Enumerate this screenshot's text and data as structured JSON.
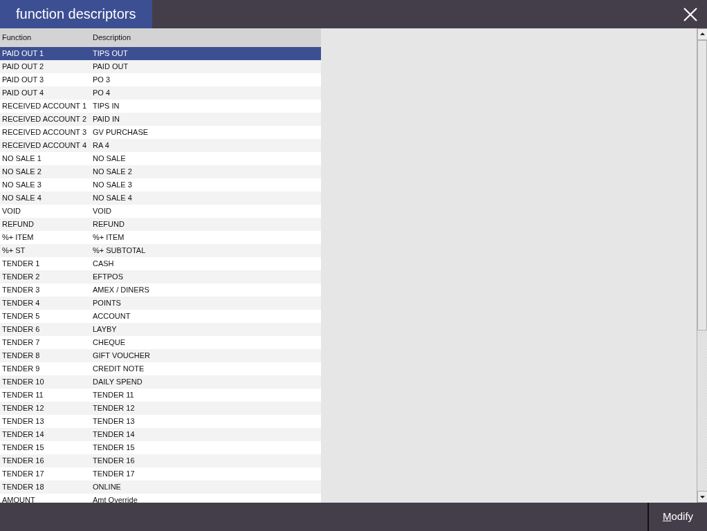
{
  "window": {
    "title": "function descriptors"
  },
  "table": {
    "columns": [
      "Function",
      "Description"
    ],
    "rows": [
      {
        "function": "PAID OUT 1",
        "description": "TIPS OUT",
        "selected": true
      },
      {
        "function": "PAID OUT 2",
        "description": "PAID OUT",
        "selected": false
      },
      {
        "function": "PAID OUT 3",
        "description": "PO 3",
        "selected": false
      },
      {
        "function": "PAID OUT 4",
        "description": "PO 4",
        "selected": false
      },
      {
        "function": "RECEIVED ACCOUNT 1",
        "description": "TIPS IN",
        "selected": false
      },
      {
        "function": "RECEIVED ACCOUNT 2",
        "description": "PAID IN",
        "selected": false
      },
      {
        "function": "RECEIVED ACCOUNT 3",
        "description": "GV PURCHASE",
        "selected": false
      },
      {
        "function": "RECEIVED ACCOUNT 4",
        "description": "RA 4",
        "selected": false
      },
      {
        "function": "NO SALE 1",
        "description": "NO SALE",
        "selected": false
      },
      {
        "function": "NO SALE 2",
        "description": "NO SALE 2",
        "selected": false
      },
      {
        "function": "NO SALE 3",
        "description": "NO SALE 3",
        "selected": false
      },
      {
        "function": "NO SALE 4",
        "description": "NO SALE 4",
        "selected": false
      },
      {
        "function": "VOID",
        "description": "VOID",
        "selected": false
      },
      {
        "function": "REFUND",
        "description": "REFUND",
        "selected": false
      },
      {
        "function": "%+ ITEM",
        "description": "%+ ITEM",
        "selected": false
      },
      {
        "function": "%+ ST",
        "description": "%+ SUBTOTAL",
        "selected": false
      },
      {
        "function": "TENDER 1",
        "description": "CASH",
        "selected": false
      },
      {
        "function": "TENDER 2",
        "description": "EFTPOS",
        "selected": false
      },
      {
        "function": "TENDER 3",
        "description": "AMEX / DINERS",
        "selected": false
      },
      {
        "function": "TENDER 4",
        "description": "POINTS",
        "selected": false
      },
      {
        "function": "TENDER 5",
        "description": "ACCOUNT",
        "selected": false
      },
      {
        "function": "TENDER 6",
        "description": "LAYBY",
        "selected": false
      },
      {
        "function": "TENDER 7",
        "description": "CHEQUE",
        "selected": false
      },
      {
        "function": "TENDER 8",
        "description": "GIFT VOUCHER",
        "selected": false
      },
      {
        "function": "TENDER 9",
        "description": "CREDIT NOTE",
        "selected": false
      },
      {
        "function": "TENDER 10",
        "description": "DAILY SPEND",
        "selected": false
      },
      {
        "function": "TENDER 11",
        "description": "TENDER 11",
        "selected": false
      },
      {
        "function": "TENDER 12",
        "description": "TENDER 12",
        "selected": false
      },
      {
        "function": "TENDER 13",
        "description": "TENDER 13",
        "selected": false
      },
      {
        "function": "TENDER 14",
        "description": "TENDER 14",
        "selected": false
      },
      {
        "function": "TENDER 15",
        "description": "TENDER 15",
        "selected": false
      },
      {
        "function": "TENDER 16",
        "description": "TENDER 16",
        "selected": false
      },
      {
        "function": "TENDER 17",
        "description": "TENDER 17",
        "selected": false
      },
      {
        "function": "TENDER 18",
        "description": "ONLINE",
        "selected": false
      },
      {
        "function": "AMOUNT",
        "description": "Amt Override",
        "selected": false
      }
    ]
  },
  "footer": {
    "button": {
      "label": "Modify",
      "access_key_underlined": true
    }
  }
}
